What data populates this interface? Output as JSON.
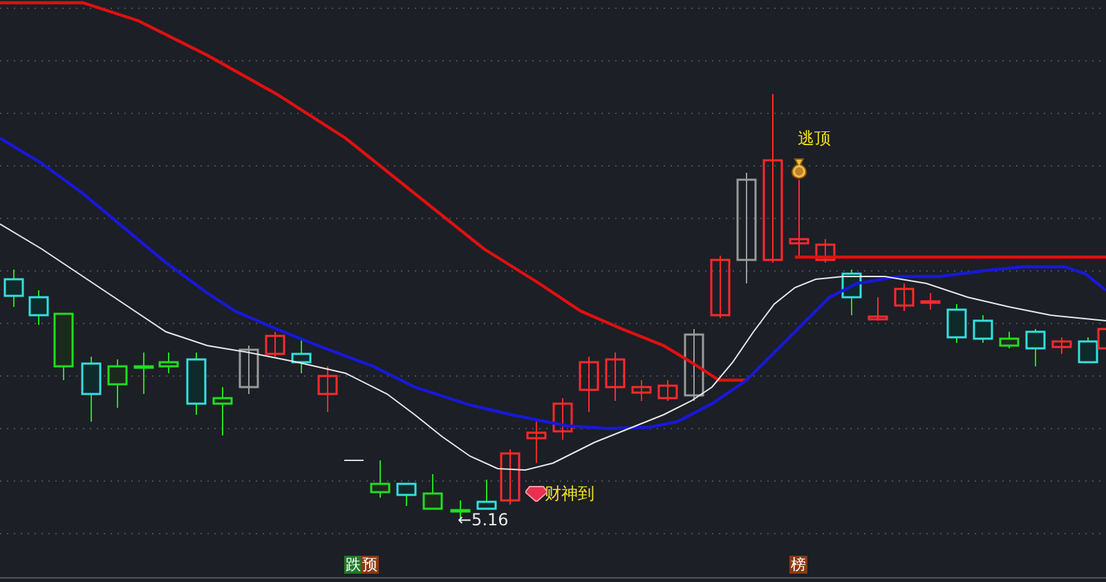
{
  "chart": {
    "labels": [
      {
        "kind": "escape-top",
        "text": "逃顶"
      },
      {
        "kind": "wealth",
        "text": "财神到"
      },
      {
        "kind": "low-price",
        "text": "←5.16"
      }
    ],
    "badges": [
      {
        "kind": "fall",
        "text": "跌",
        "color": "#1f7a2a"
      },
      {
        "kind": "forecast",
        "text": "预",
        "color": "#8a3a10"
      },
      {
        "kind": "rank",
        "text": "榜",
        "color": "#8a3a10"
      }
    ]
  }
}
